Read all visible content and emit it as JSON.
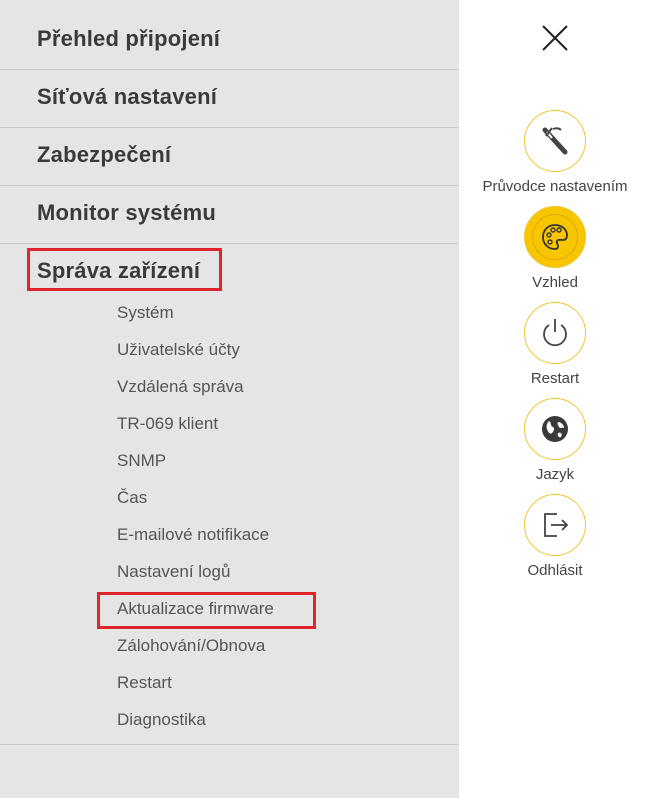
{
  "menu": {
    "items": [
      {
        "label": "Přehled připojení"
      },
      {
        "label": "Síťová nastavení"
      },
      {
        "label": "Zabezpečení"
      },
      {
        "label": "Monitor systému"
      },
      {
        "label": "Správa zařízení"
      }
    ],
    "subitems": [
      {
        "label": "Systém"
      },
      {
        "label": "Uživatelské účty"
      },
      {
        "label": "Vzdálená správa"
      },
      {
        "label": "TR-069 klient"
      },
      {
        "label": "SNMP"
      },
      {
        "label": "Čas"
      },
      {
        "label": "E-mailové notifikace"
      },
      {
        "label": "Nastavení logů"
      },
      {
        "label": "Aktualizace firmware"
      },
      {
        "label": "Zálohování/Obnova"
      },
      {
        "label": "Restart"
      },
      {
        "label": "Diagnostika"
      }
    ]
  },
  "side": {
    "wizard_label": "Průvodce nastavením",
    "theme_label": "Vzhled",
    "restart_label": "Restart",
    "language_label": "Jazyk",
    "logout_label": "Odhlásit"
  },
  "icons": {
    "close": "close-icon",
    "wizard": "wand-icon",
    "theme": "palette-icon",
    "restart": "power-icon",
    "language": "globe-icon",
    "logout": "logout-icon"
  },
  "colors": {
    "accent": "#f8c600",
    "highlight": "#e0262c",
    "panel": "#e5e5e5"
  }
}
